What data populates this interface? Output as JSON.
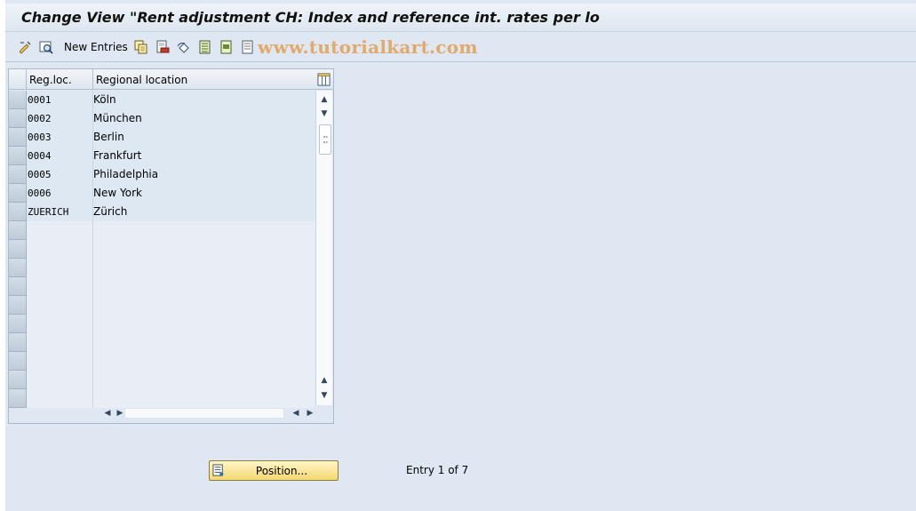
{
  "window": {
    "title": "Change View \"Rent adjustment CH: Index and reference int. rates per lo"
  },
  "toolbar": {
    "new_entries_label": "New Entries",
    "watermark": "www.tutorialkart.com",
    "icons": [
      "display-change-icon",
      "details-icon",
      "copy-as-icon",
      "delete-icon",
      "undo-change-icon",
      "select-all-icon",
      "select-block-icon",
      "deselect-all-icon"
    ]
  },
  "table": {
    "columns": [
      "Reg.loc.",
      "Regional location"
    ],
    "rows": [
      {
        "code": "0001",
        "name": "Köln"
      },
      {
        "code": "0002",
        "name": "München"
      },
      {
        "code": "0003",
        "name": "Berlin"
      },
      {
        "code": "0004",
        "name": "Frankfurt"
      },
      {
        "code": "0005",
        "name": "Philadelphia"
      },
      {
        "code": "0006",
        "name": "New York"
      },
      {
        "code": "ZUERICH",
        "name": "Zürich"
      }
    ]
  },
  "footer": {
    "position_label": "Position...",
    "entry_info": "Entry 1 of 7"
  },
  "colors": {
    "background": "#dfe8f2",
    "button_yellow": "#f4d870",
    "watermark": "#e1a96a"
  }
}
